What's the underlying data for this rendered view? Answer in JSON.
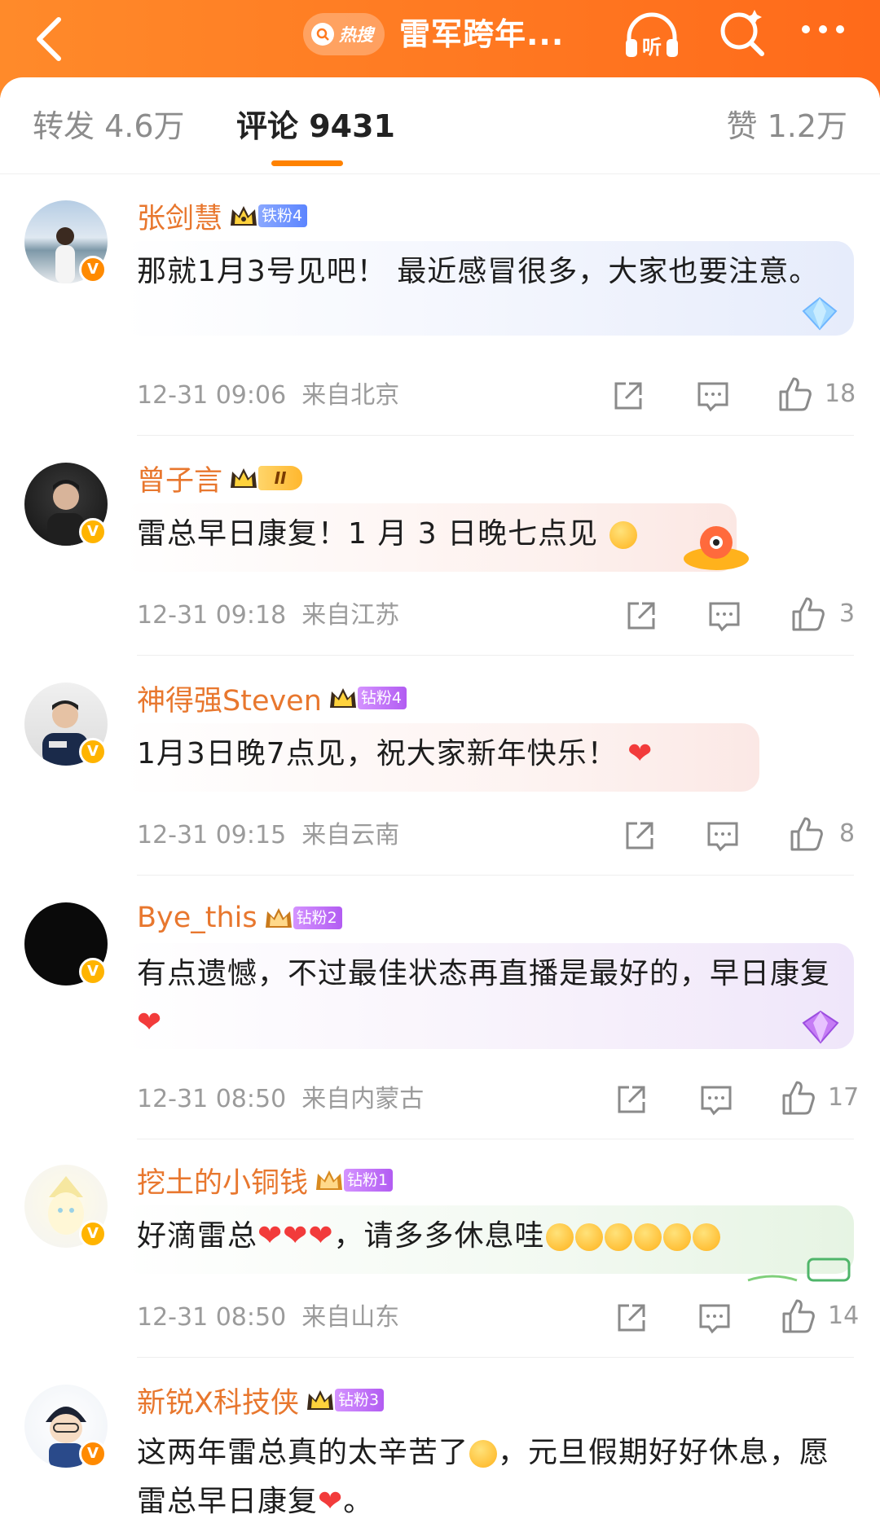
{
  "header": {
    "hot_label": "热搜",
    "title": "雷军跨年..."
  },
  "tabs": [
    {
      "label": "转发 4.6万"
    },
    {
      "label": "评论 9431"
    },
    {
      "label": "赞 1.2万"
    }
  ],
  "comments": [
    {
      "username": "张剑慧",
      "fan_badge": "铁粉4",
      "text": "那就1月3号见吧！ 最近感冒很多，大家也要注意。",
      "time": "12-31 09:06",
      "location": "来自北京",
      "likes": "18"
    },
    {
      "username": "曾子言",
      "level_badge": "II",
      "text": "雷总早日康复！1 月 3 日晚七点见",
      "time": "12-31 09:18",
      "location": "来自江苏",
      "likes": "3"
    },
    {
      "username": "神得强Steven",
      "fan_badge": "钻粉4",
      "text": "1月3日晚7点见，祝大家新年快乐！",
      "heart": "❤",
      "time": "12-31 09:15",
      "location": "来自云南",
      "likes": "8"
    },
    {
      "username": "Bye_this",
      "fan_badge": "钻粉2",
      "text": "有点遗憾，不过最佳状态再直播是最好的，早日康复",
      "heart": "❤",
      "time": "12-31 08:50",
      "location": "来自内蒙古",
      "likes": "17"
    },
    {
      "username": "挖土的小铜钱",
      "fan_badge": "钻粉1",
      "text_a": "好滴雷总",
      "hearts": "❤❤❤",
      "text_b": "，请多多休息哇",
      "time": "12-31 08:50",
      "location": "来自山东",
      "likes": "14"
    },
    {
      "username": "新锐X科技侠",
      "fan_badge": "钻粉3",
      "text_a": "这两年雷总真的太辛苦了",
      "text_b": "，元旦假期好好休息，愿雷总早日康复",
      "heart": "❤",
      "text_c": "。"
    }
  ],
  "colors": {
    "header_orange": "#ff7a1f",
    "username": "#e8772e",
    "tab_underline": "#ff8200",
    "meta_gray": "#9b9b9b"
  }
}
